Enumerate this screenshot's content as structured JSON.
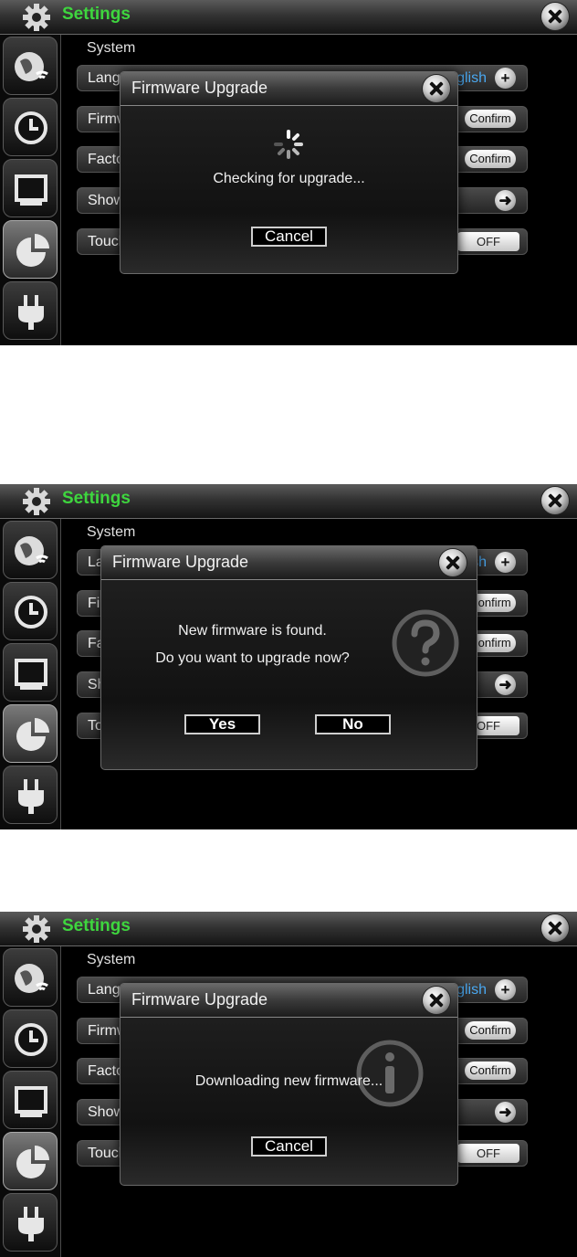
{
  "app": {
    "title": "Settings",
    "section": "System",
    "rows": {
      "language": {
        "label": "Language",
        "value": "English"
      },
      "firmware": {
        "label": "Firmware Upgrade",
        "button": "Confirm"
      },
      "factory": {
        "label": "Factory Default",
        "button": "Confirm"
      },
      "show": {
        "label": "Show"
      },
      "touch": {
        "label": "Touch",
        "toggle": "OFF"
      }
    },
    "sidebar_icons": [
      "wifi-globe-icon",
      "clock-icon",
      "display-icon",
      "pie-chart-icon",
      "power-plug-icon"
    ]
  },
  "dialogs": {
    "checking": {
      "title": "Firmware Upgrade",
      "message": "Checking for upgrade...",
      "cancel": "Cancel"
    },
    "found": {
      "title": "Firmware Upgrade",
      "line1": "New firmware is found.",
      "line2": "Do you want to upgrade now?",
      "yes": "Yes",
      "no": "No"
    },
    "downloading": {
      "title": "Firmware Upgrade",
      "message": "Downloading new firmware...",
      "cancel": "Cancel"
    }
  },
  "colors": {
    "title_green": "#3ed63e",
    "value_blue": "#4aa8f0"
  }
}
